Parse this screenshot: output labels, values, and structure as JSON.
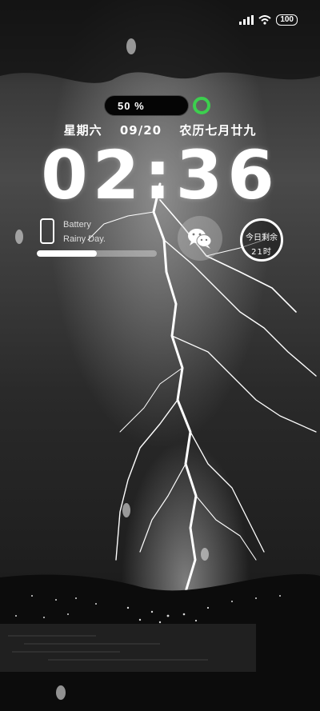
{
  "status_bar": {
    "battery": "100",
    "signal_icon": "signal-bars-icon",
    "wifi_icon": "wifi-icon"
  },
  "charge": {
    "percent_label": "50 %",
    "ring_icon": "green-ring-icon",
    "ring_color": "#3ccf4e"
  },
  "date": {
    "weekday": "星期六",
    "date": "09/20",
    "lunar": "农历七月廿九"
  },
  "clock": {
    "time": "02:36"
  },
  "battery_widget": {
    "title": "Battery",
    "subtitle": "Rainy Day.",
    "level": 0.5,
    "icon": "phone-icon"
  },
  "wechat_widget": {
    "icon": "wechat-icon"
  },
  "day_widget": {
    "line1": "今日剩余",
    "line2": "21时"
  }
}
